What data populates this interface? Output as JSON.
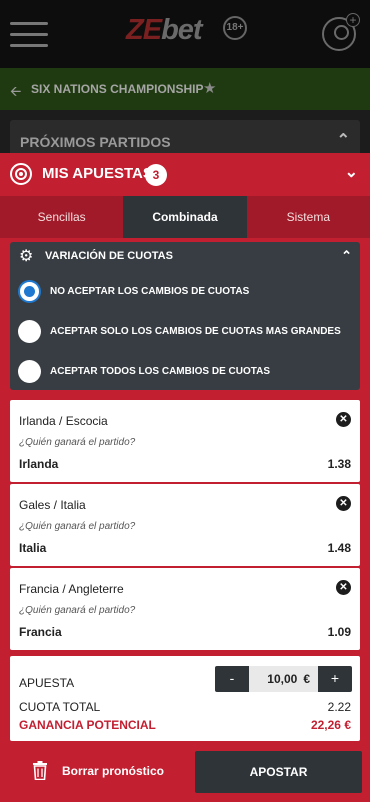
{
  "header": {
    "logo_ze": "ZE",
    "logo_bet": "bet",
    "age_badge": "18+",
    "icons": [
      "hamburger-menu-icon",
      "user-add-icon"
    ]
  },
  "championship": {
    "title": "SIX NATIONS CHAMPIONSHIP",
    "back_icon": "arrow-left-icon",
    "star_icon": "star-icon"
  },
  "upcoming": {
    "title": "PRÓXIMOS PARTIDOS",
    "chevron_icon": "chevron-up-icon"
  },
  "betslip": {
    "title": "MIS APUESTAS",
    "count": "3",
    "icon": "target-icon",
    "collapse_icon": "chevron-down-icon",
    "accent": "#c21f31",
    "tabs": [
      {
        "label": "Sencillas",
        "active": false
      },
      {
        "label": "Combinada",
        "active": true
      },
      {
        "label": "Sistema",
        "active": false
      }
    ],
    "odds_variation": {
      "title": "VARIACIÓN DE CUOTAS",
      "options": [
        {
          "label": "NO ACEPTAR LOS CAMBIOS DE CUOTAS",
          "selected": true
        },
        {
          "label": "ACEPTAR SOLO LOS CAMBIOS DE CUOTAS MAS GRANDES",
          "selected": false
        },
        {
          "label": "ACEPTAR TODOS LOS CAMBIOS DE CUOTAS",
          "selected": false
        }
      ]
    },
    "bets": [
      {
        "match": "Irlanda / Escocia",
        "question": "¿Quién ganará el partido?",
        "pick": "Irlanda",
        "odd": "1.38"
      },
      {
        "match": "Gales / Italia",
        "question": "¿Quién ganará el partido?",
        "pick": "Italia",
        "odd": "1.48"
      },
      {
        "match": "Francia / Angleterre",
        "question": "¿Quién ganará el partido?",
        "pick": "Francia",
        "odd": "1.09"
      }
    ],
    "summary": {
      "stake_label": "APUESTA",
      "stake_value": "10,00",
      "currency": "€",
      "minus": "-",
      "plus": "+",
      "total_odds_label": "CUOTA TOTAL",
      "total_odds_value": "2.22",
      "potential_gain_label": "GANANCIA POTENCIAL",
      "potential_gain_value": "22,26 €"
    },
    "clear_label": "Borrar pronóstico",
    "place_bet_label": "APOSTAR"
  }
}
